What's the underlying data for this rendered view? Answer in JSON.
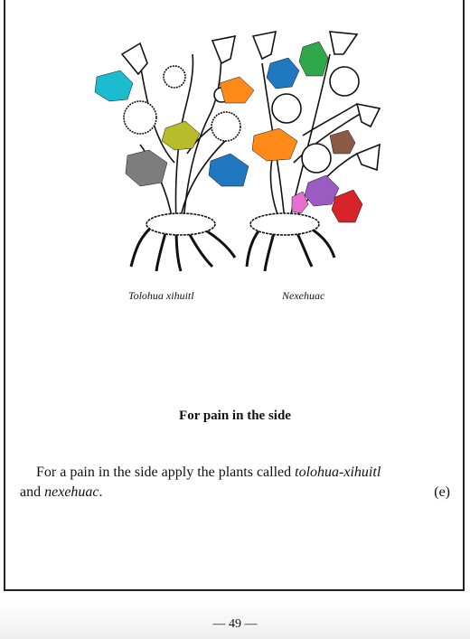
{
  "captions": {
    "left": "Tolohua xihuitl",
    "right": "Nexehuac"
  },
  "heading": "For pain in the side",
  "paragraph": {
    "line1_prefix": "For a pain in the side apply the plants called ",
    "plant1": "tolohua-xihuitl",
    "line2_prefix": "and ",
    "plant2": "nexehuac",
    "line2_suffix": ".",
    "ref": "(e)"
  },
  "page_number": "— 49 —",
  "leaf_colors": {
    "cyan": "#1bbcd0",
    "orange": "#ff8a1a",
    "olive": "#b8bb2a",
    "gray": "#7d7d7d",
    "blue": "#1f78c0",
    "green": "#2ea84a",
    "brown": "#8a5a44",
    "purple": "#9a5cc0",
    "pink": "#e46fd0",
    "red": "#d8232a"
  }
}
